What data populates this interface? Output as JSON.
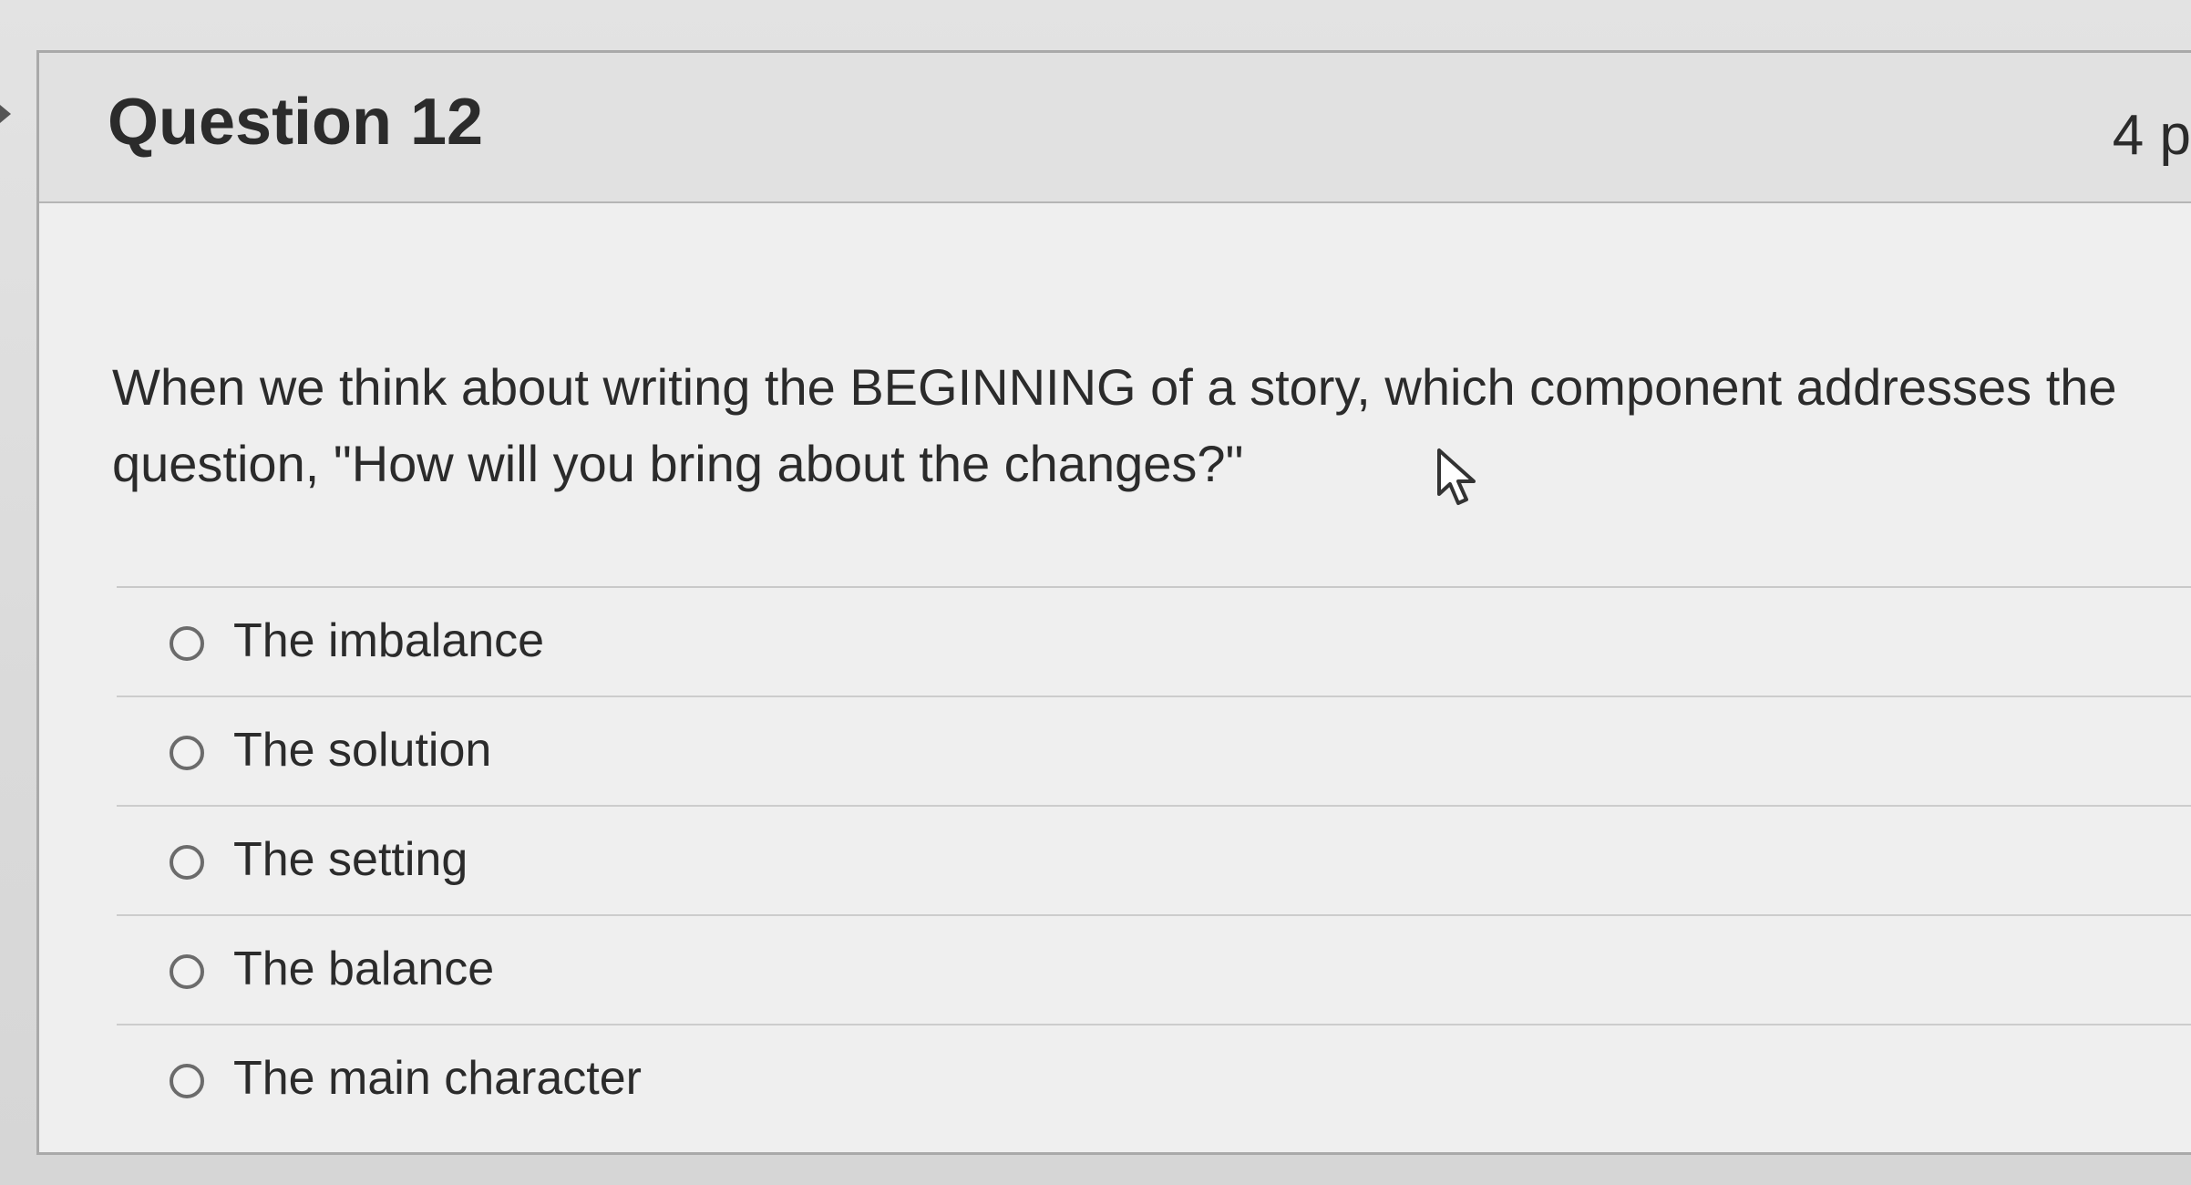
{
  "question": {
    "title": "Question 12",
    "points": "4 p",
    "text": "When we think about writing the BEGINNING of a story, which component addresses the question, \"How will you bring about the changes?\"",
    "answers": [
      {
        "label": "The imbalance",
        "selected": false
      },
      {
        "label": "The solution",
        "selected": false
      },
      {
        "label": "The setting",
        "selected": false
      },
      {
        "label": "The balance",
        "selected": false
      },
      {
        "label": "The main character",
        "selected": false
      }
    ]
  },
  "icons": {
    "cursor": "mouse-pointer-icon",
    "radio": "radio-button-icon"
  },
  "colors": {
    "text": "#2b2b2b",
    "header_bg": "#e1e1e1",
    "card_bg": "#efefef",
    "border": "#a9a9a9"
  }
}
